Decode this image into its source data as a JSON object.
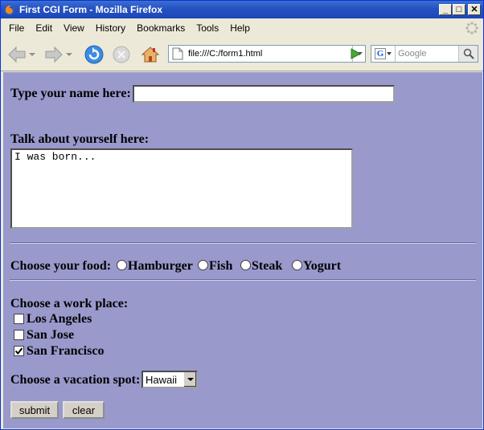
{
  "window": {
    "title": "First CGI Form - Mozilla Firefox",
    "controls": {
      "minimize": "_",
      "maximize": "□",
      "close": "✕"
    }
  },
  "menu": {
    "items": [
      "File",
      "Edit",
      "View",
      "History",
      "Bookmarks",
      "Tools",
      "Help"
    ]
  },
  "toolbar": {
    "url": "file:///C:/form1.html",
    "search_placeholder": "Google",
    "search_engine": "G"
  },
  "form": {
    "name_label": "Type your name here:",
    "name_value": "",
    "about_label": "Talk about yourself here:",
    "about_value": "I was born...",
    "food_label": "Choose your food:",
    "food_options": [
      "Hamburger",
      "Fish",
      "Steak",
      "Yogurt"
    ],
    "work_label": "Choose a work place:",
    "work_options": [
      {
        "label": "Los Angeles",
        "checked": false
      },
      {
        "label": "San Jose",
        "checked": false
      },
      {
        "label": "San Francisco",
        "checked": true
      }
    ],
    "vacation_label": "Choose a vacation spot:",
    "vacation_selected": "Hawaii",
    "submit_label": "submit",
    "clear_label": "clear"
  },
  "colors": {
    "page_background": "#9999cc",
    "title_bar": "#2654c4",
    "chrome": "#ece9d8"
  }
}
